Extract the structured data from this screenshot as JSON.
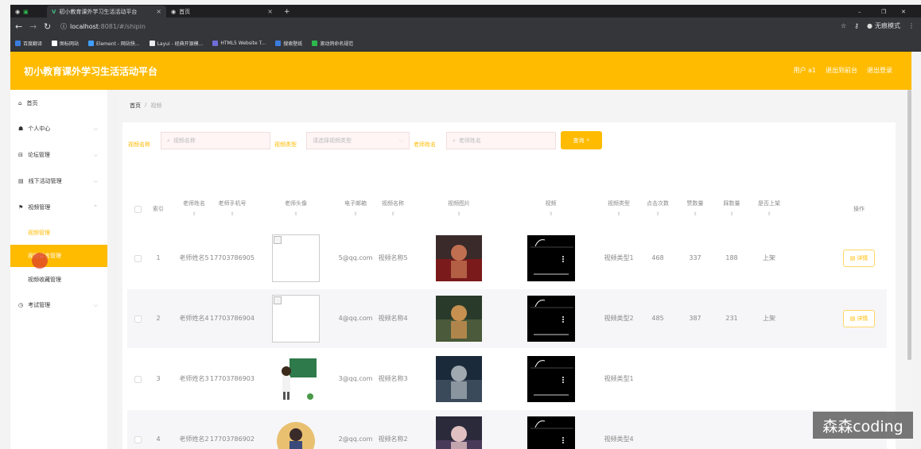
{
  "browser": {
    "tabs": [
      {
        "title": "初小教育课外学习生活活动平台",
        "close": "×"
      },
      {
        "title": "首页",
        "close": "×"
      }
    ],
    "new_tab": "+",
    "window_controls": [
      "–",
      "❐",
      "✕"
    ],
    "url_host": "localhost",
    "url_rest": ":8081/#/shipin",
    "incognito_label": "无痕模式",
    "bookmarks": [
      {
        "label": "百度翻译",
        "color": "#3b7ddd"
      },
      {
        "label": "图标网站",
        "color": "#ffffff"
      },
      {
        "label": "Element - 网站快...",
        "color": "#409eff"
      },
      {
        "label": "Layui - 经典开源模...",
        "color": "#e8eaed"
      },
      {
        "label": "HTML5 Website T...",
        "color": "#6f6cd8"
      },
      {
        "label": "搜索壁纸",
        "color": "#3b7ddd"
      },
      {
        "label": "滚动鸽命名规范",
        "color": "#2db84d"
      }
    ]
  },
  "header": {
    "title": "初小教育课外学习生活活动平台",
    "user": "用户 a1",
    "back_front": "退出到前台",
    "logout": "退出登录"
  },
  "sidebar": {
    "items": [
      {
        "label": "首页",
        "icon": "home-icon",
        "glyph": "⌂"
      },
      {
        "label": "个人中心",
        "icon": "user-icon",
        "glyph": "☗"
      },
      {
        "label": "论坛管理",
        "icon": "forum-icon",
        "glyph": "⊟"
      },
      {
        "label": "线下活动管理",
        "icon": "chart-icon",
        "glyph": "▤"
      },
      {
        "label": "视频管理",
        "icon": "flag-icon",
        "glyph": "⚑"
      }
    ],
    "submenu": [
      "视频管理",
      "视频留言管理",
      "视频收藏管理"
    ],
    "last_item": {
      "label": "考试管理",
      "icon": "clock-icon",
      "glyph": "◷"
    }
  },
  "breadcrumb": {
    "home": "首页",
    "sep": "/",
    "current": "视频"
  },
  "search": {
    "name_label": "视频名称",
    "name_placeholder": "视频名称",
    "type_label": "视频类型",
    "type_placeholder": "请选择视频类型",
    "teacher_label": "老师姓名",
    "teacher_placeholder": "老师姓名",
    "button": "查询"
  },
  "table": {
    "headers": [
      "索引",
      "老师姓名",
      "老师手机号",
      "老师头像",
      "电子邮箱",
      "视频名称",
      "视频图片",
      "视频",
      "视频类型",
      "点击次数",
      "赞数量",
      "踩数量",
      "是否上架",
      "操作"
    ],
    "detail_label": "详情",
    "rows": [
      {
        "idx": "1",
        "teacher": "老师姓名5",
        "phone": "17703786905",
        "email": "5@qq.com",
        "video": "视频名称5",
        "type": "视频类型1",
        "clicks": "468",
        "likes": "337",
        "dislikes": "188",
        "status": "上架"
      },
      {
        "idx": "2",
        "teacher": "老师姓名4",
        "phone": "17703786904",
        "email": "4@qq.com",
        "video": "视频名称4",
        "type": "视频类型2",
        "clicks": "485",
        "likes": "387",
        "dislikes": "231",
        "status": "上架"
      },
      {
        "idx": "3",
        "teacher": "老师姓名3",
        "phone": "17703786903",
        "email": "3@qq.com",
        "video": "视频名称3",
        "type": "视频类型1",
        "clicks": "",
        "likes": "",
        "dislikes": "",
        "status": ""
      },
      {
        "idx": "4",
        "teacher": "老师姓名2",
        "phone": "17703786902",
        "email": "2@qq.com",
        "video": "视频名称2",
        "type": "视频类型4",
        "clicks": "",
        "likes": "",
        "dislikes": "",
        "status": ""
      }
    ]
  },
  "watermark": "森森coding",
  "colors": {
    "accent": "#ffbb00",
    "chrome_dark": "#35363a"
  }
}
